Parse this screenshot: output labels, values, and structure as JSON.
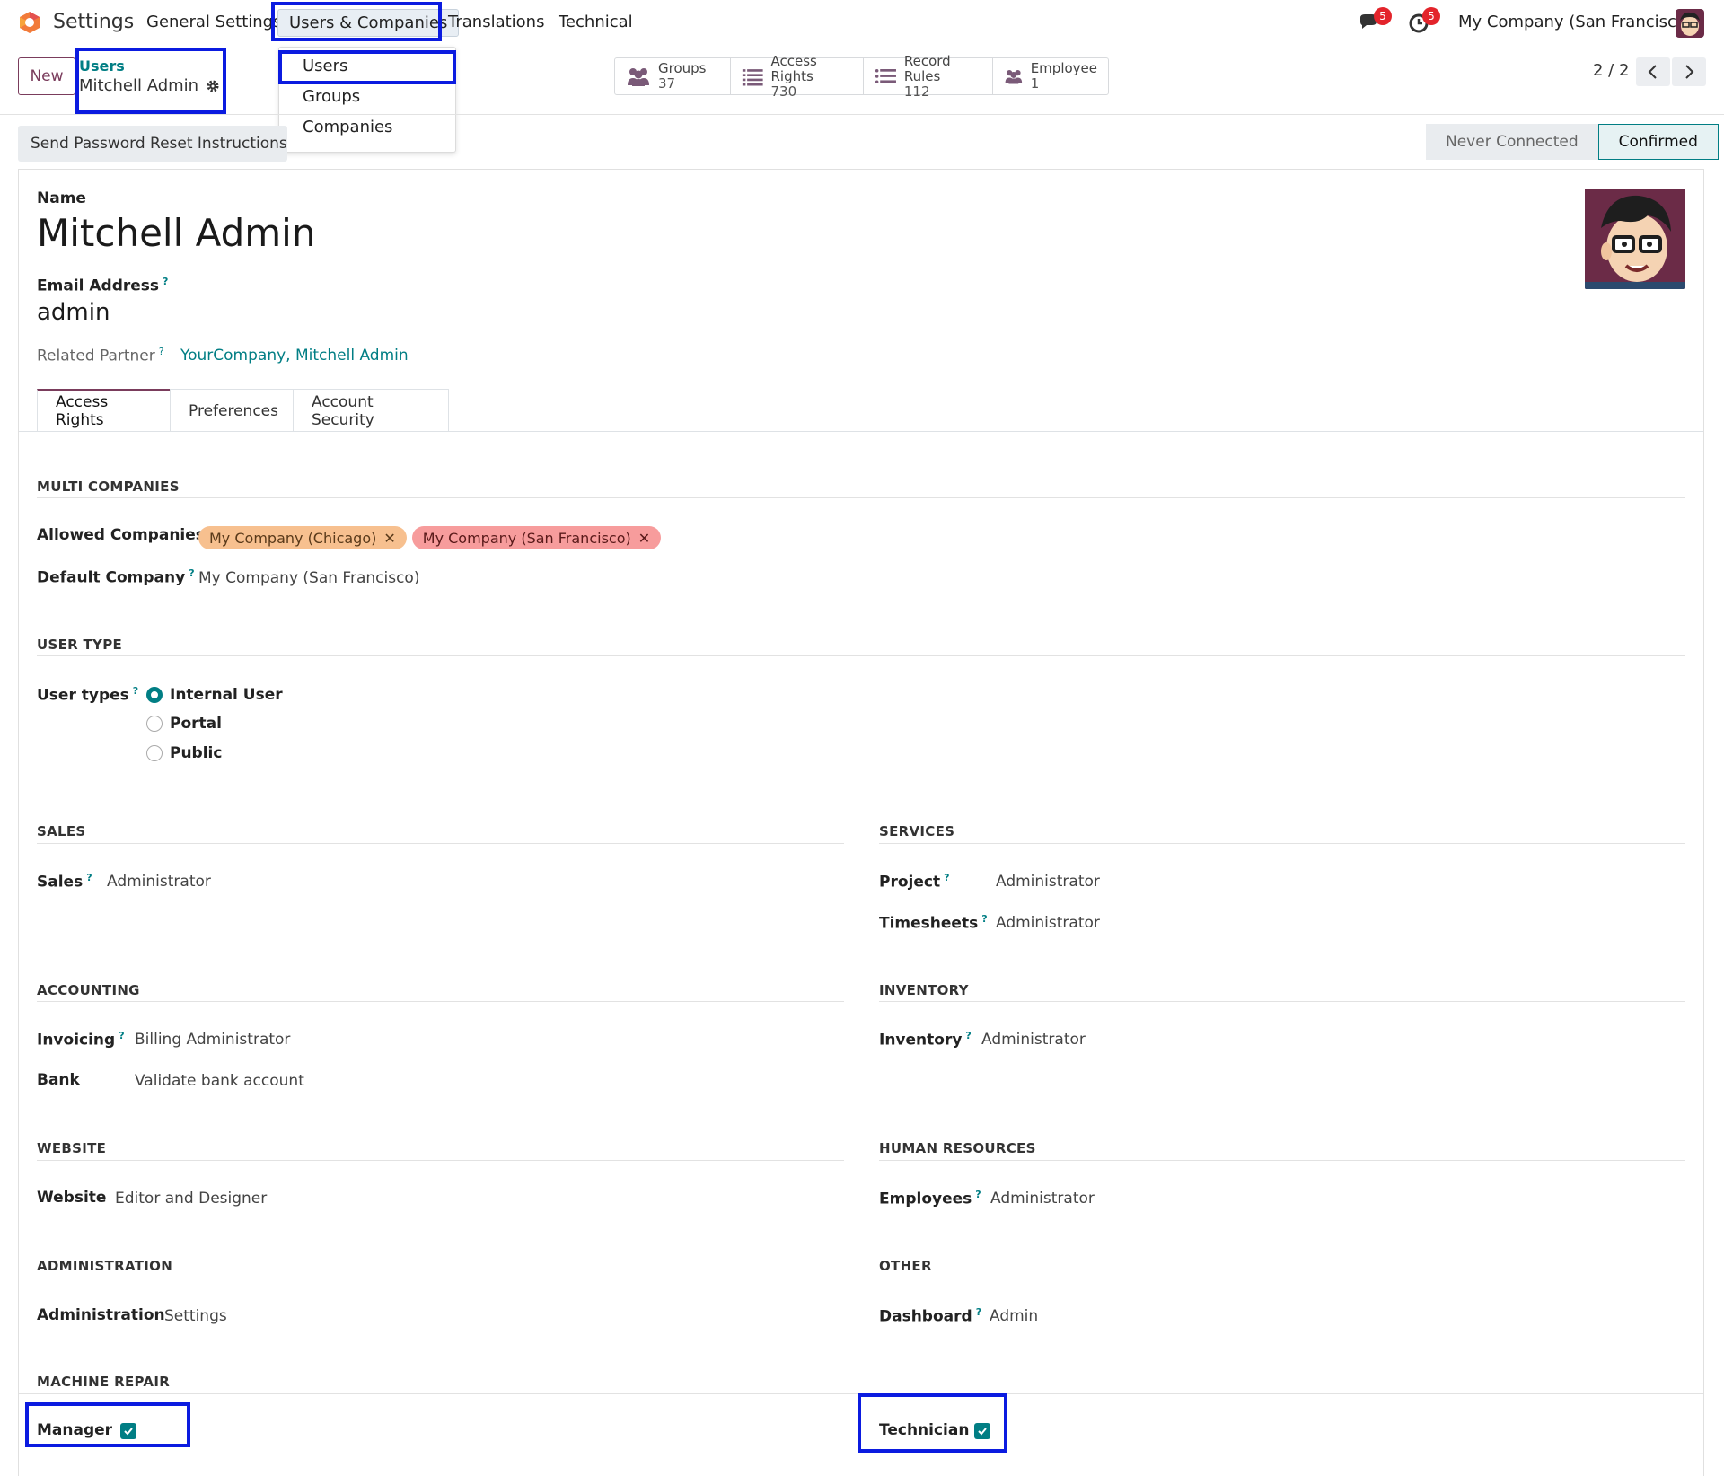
{
  "navbar": {
    "app_name": "Settings",
    "menu": [
      "General Settings",
      "Users & Companies",
      "Translations",
      "Technical"
    ],
    "messages_count": "5",
    "activities_count": "5",
    "company": "My Company (San Francisco)"
  },
  "dropdown": {
    "items": [
      "Users",
      "Groups",
      "Companies"
    ]
  },
  "control": {
    "new_label": "New",
    "breadcrumb_parent": "Users",
    "breadcrumb_current": "Mitchell Admin",
    "pager": "2 / 2"
  },
  "stats": [
    {
      "label": "Groups",
      "value": "37",
      "icon": "users-icon"
    },
    {
      "label": "Access Rights",
      "value": "730",
      "icon": "list-icon"
    },
    {
      "label": "Record Rules",
      "value": "112",
      "icon": "list-icon"
    },
    {
      "label": "Employee",
      "value": "1",
      "icon": "users-icon"
    }
  ],
  "actions": {
    "reset_password": "Send Password Reset Instructions"
  },
  "status": {
    "steps": [
      "Never Connected",
      "Confirmed"
    ],
    "current": "Confirmed"
  },
  "form": {
    "name_label": "Name",
    "name": "Mitchell Admin",
    "email_label": "Email Address",
    "email": "admin",
    "partner_label": "Related Partner",
    "partner": "YourCompany, Mitchell Admin"
  },
  "tabs": [
    "Access Rights",
    "Preferences",
    "Account Security"
  ],
  "multi_companies": {
    "title": "MULTI COMPANIES",
    "allowed_label": "Allowed Companies",
    "allowed": [
      "My Company (Chicago)",
      "My Company (San Francisco)"
    ],
    "default_label": "Default Company",
    "default": "My Company (San Francisco)"
  },
  "user_type": {
    "title": "USER TYPE",
    "label": "User types",
    "options": [
      "Internal User",
      "Portal",
      "Public"
    ],
    "selected": "Internal User"
  },
  "sections": {
    "sales": {
      "title": "SALES",
      "rows": [
        {
          "label": "Sales",
          "value": "Administrator"
        }
      ]
    },
    "services": {
      "title": "SERVICES",
      "rows": [
        {
          "label": "Project",
          "value": "Administrator"
        },
        {
          "label": "Timesheets",
          "value": "Administrator"
        }
      ]
    },
    "accounting": {
      "title": "ACCOUNTING",
      "rows": [
        {
          "label": "Invoicing",
          "value": "Billing Administrator"
        },
        {
          "label": "Bank",
          "value": "Validate bank account"
        }
      ]
    },
    "inventory": {
      "title": "INVENTORY",
      "rows": [
        {
          "label": "Inventory",
          "value": "Administrator"
        }
      ]
    },
    "website": {
      "title": "WEBSITE",
      "rows": [
        {
          "label": "Website",
          "value": "Editor and Designer"
        }
      ]
    },
    "hr": {
      "title": "HUMAN RESOURCES",
      "rows": [
        {
          "label": "Employees",
          "value": "Administrator"
        }
      ]
    },
    "administration": {
      "title": "ADMINISTRATION",
      "rows": [
        {
          "label": "Administration",
          "value": "Settings"
        }
      ]
    },
    "other": {
      "title": "OTHER",
      "rows": [
        {
          "label": "Dashboard",
          "value": "Admin"
        }
      ]
    },
    "machine_repair": {
      "title": "MACHINE REPAIR",
      "manager_label": "Manager",
      "manager_checked": true,
      "technician_label": "Technician",
      "technician_checked": true
    }
  },
  "colors": {
    "primary": "#7a3c5c",
    "teal": "#017e84",
    "highlight": "#0b1be0"
  }
}
